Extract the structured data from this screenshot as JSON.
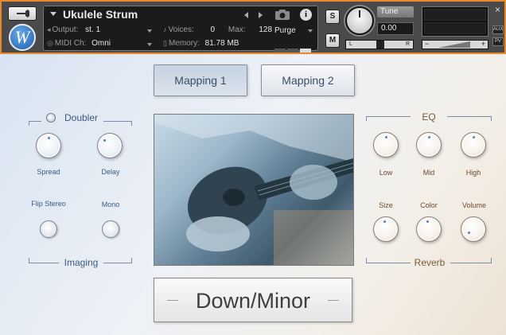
{
  "header": {
    "instrument_name": "Ukulele Strum",
    "output_label": "Output:",
    "output_value": "st. 1",
    "midi_label": "MIDI Ch:",
    "midi_value": "Omni",
    "voices_label": "Voices:",
    "voices_value": "0",
    "max_label": "Max:",
    "max_value": "128",
    "memory_label": "Memory:",
    "memory_value": "81.78 MB",
    "purge_label": "Purge",
    "solo_label": "S",
    "mute_label": "M",
    "tune_label": "Tune",
    "tune_value": "0.00",
    "pan_left": "L",
    "pan_right": "R",
    "vol_minus": "−",
    "vol_plus": "+",
    "close_label": "×",
    "aux_label": "AUX",
    "pv_label": "PV",
    "logo_letter": "W",
    "accent_color": "#e8892b"
  },
  "mapping": {
    "tab1_label": "Mapping 1",
    "tab2_label": "Mapping 2",
    "active": 1
  },
  "doubler": {
    "title": "Doubler",
    "spread_label": "Spread",
    "delay_label": "Delay"
  },
  "imaging": {
    "title": "Imaging",
    "flip_stereo_label": "Flip Stereo",
    "mono_label": "Mono"
  },
  "eq": {
    "title": "EQ",
    "low_label": "Low",
    "mid_label": "Mid",
    "high_label": "High"
  },
  "reverb": {
    "title": "Reverb",
    "size_label": "Size",
    "color_label": "Color",
    "volume_label": "Volume"
  },
  "state_display": "Down/Minor"
}
